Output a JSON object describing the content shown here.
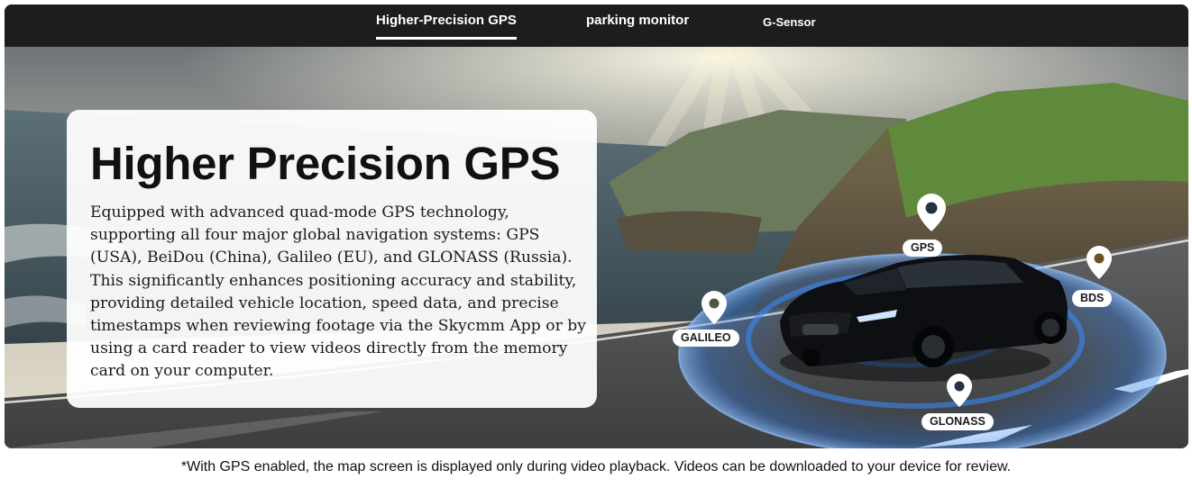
{
  "tabs": [
    {
      "label": "Higher-Precision GPS",
      "active": true
    },
    {
      "label": "parking monitor",
      "active": false
    },
    {
      "label": "G-Sensor",
      "active": false
    }
  ],
  "hero": {
    "title": "Higher Precision GPS",
    "body": "Equipped with advanced quad-mode GPS technology, supporting all four major global navigation systems: GPS (USA), BeiDou (China), Galileo (EU), and GLONASS (Russia). This significantly enhances positioning accuracy and stability, providing detailed vehicle location, speed data, and precise timestamps when reviewing footage via the Skycmm App or by using a card reader to view videos directly from the memory card on your computer.",
    "pins": [
      {
        "label": "GPS",
        "icon": "location-pin-icon"
      },
      {
        "label": "BDS",
        "icon": "location-pin-icon"
      },
      {
        "label": "GALILEO",
        "icon": "location-pin-icon"
      },
      {
        "label": "GLONASS",
        "icon": "location-pin-icon"
      }
    ]
  },
  "footnote": "*With GPS enabled, the map screen is displayed only during video playback. Videos can be downloaded to your device for review.",
  "colors": {
    "tab_bar": "#1c1d1f",
    "signal_ring": "#2f7be8",
    "car": "#0d0f12"
  }
}
